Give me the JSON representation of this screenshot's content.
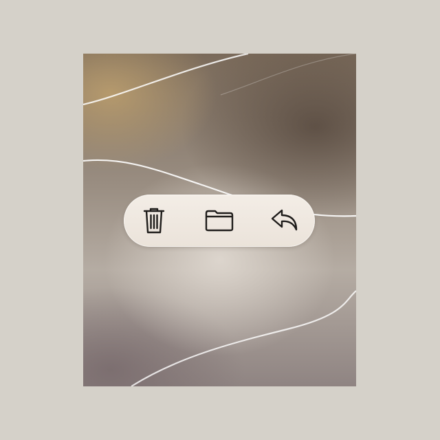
{
  "toolbar": {
    "buttons": [
      {
        "id": "delete",
        "icon": "trash-icon"
      },
      {
        "id": "move",
        "icon": "folder-icon"
      },
      {
        "id": "reply",
        "icon": "reply-arrow-icon"
      }
    ]
  },
  "colors": {
    "background": "#d5d1c9",
    "toolbar_fill": "#efe8e0",
    "icon_stroke": "#1e1c1a"
  }
}
